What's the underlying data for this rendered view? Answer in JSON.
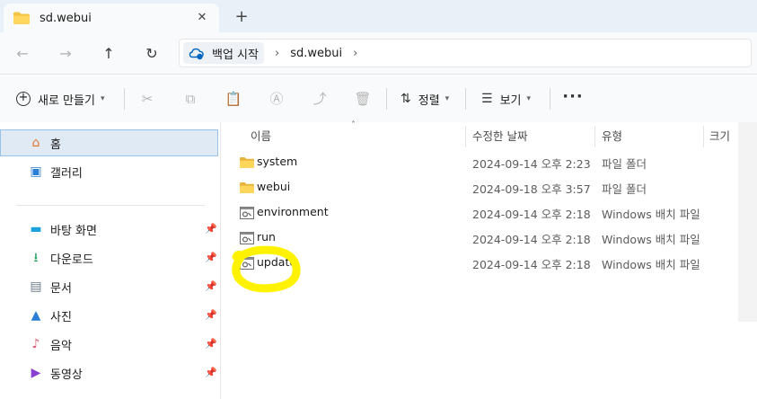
{
  "tab": {
    "title": "sd.webui",
    "close": "✕",
    "new_tab": "+"
  },
  "nav": {
    "back": "←",
    "forward": "→",
    "up": "↑",
    "refresh": "↻"
  },
  "address": {
    "root": "백업 시작",
    "sep": "›",
    "folder": "sd.webui"
  },
  "commands": {
    "new_label": "새로 만들기",
    "sort_label": "정렬",
    "view_label": "보기",
    "more": "···"
  },
  "sidebar": {
    "items": [
      {
        "label": "홈",
        "icon": "home-icon"
      },
      {
        "label": "갤러리",
        "icon": "gallery-icon"
      },
      {
        "label": "바탕 화면",
        "icon": "desktop-icon"
      },
      {
        "label": "다운로드",
        "icon": "download-icon"
      },
      {
        "label": "문서",
        "icon": "documents-icon"
      },
      {
        "label": "사진",
        "icon": "pictures-icon"
      },
      {
        "label": "음악",
        "icon": "music-icon"
      },
      {
        "label": "동영상",
        "icon": "videos-icon"
      }
    ]
  },
  "columns": {
    "name": "이름",
    "date": "수정한 날짜",
    "type": "유형",
    "size": "크기"
  },
  "files": [
    {
      "name": "system",
      "date": "2024-09-14 오후 2:23",
      "type": "파일 폴더",
      "kind": "folder"
    },
    {
      "name": "webui",
      "date": "2024-09-18 오후 3:57",
      "type": "파일 폴더",
      "kind": "folder"
    },
    {
      "name": "environment",
      "date": "2024-09-14 오후 2:18",
      "type": "Windows 배치 파일",
      "kind": "batch"
    },
    {
      "name": "run",
      "date": "2024-09-14 오후 2:18",
      "type": "Windows 배치 파일",
      "kind": "batch"
    },
    {
      "name": "update",
      "date": "2024-09-14 오후 2:18",
      "type": "Windows 배치 파일",
      "kind": "batch"
    }
  ],
  "colors": {
    "accent": "#0067c0",
    "folder": "#f4c542",
    "highlight": "#fff200",
    "selection": "#dfeaf5"
  }
}
